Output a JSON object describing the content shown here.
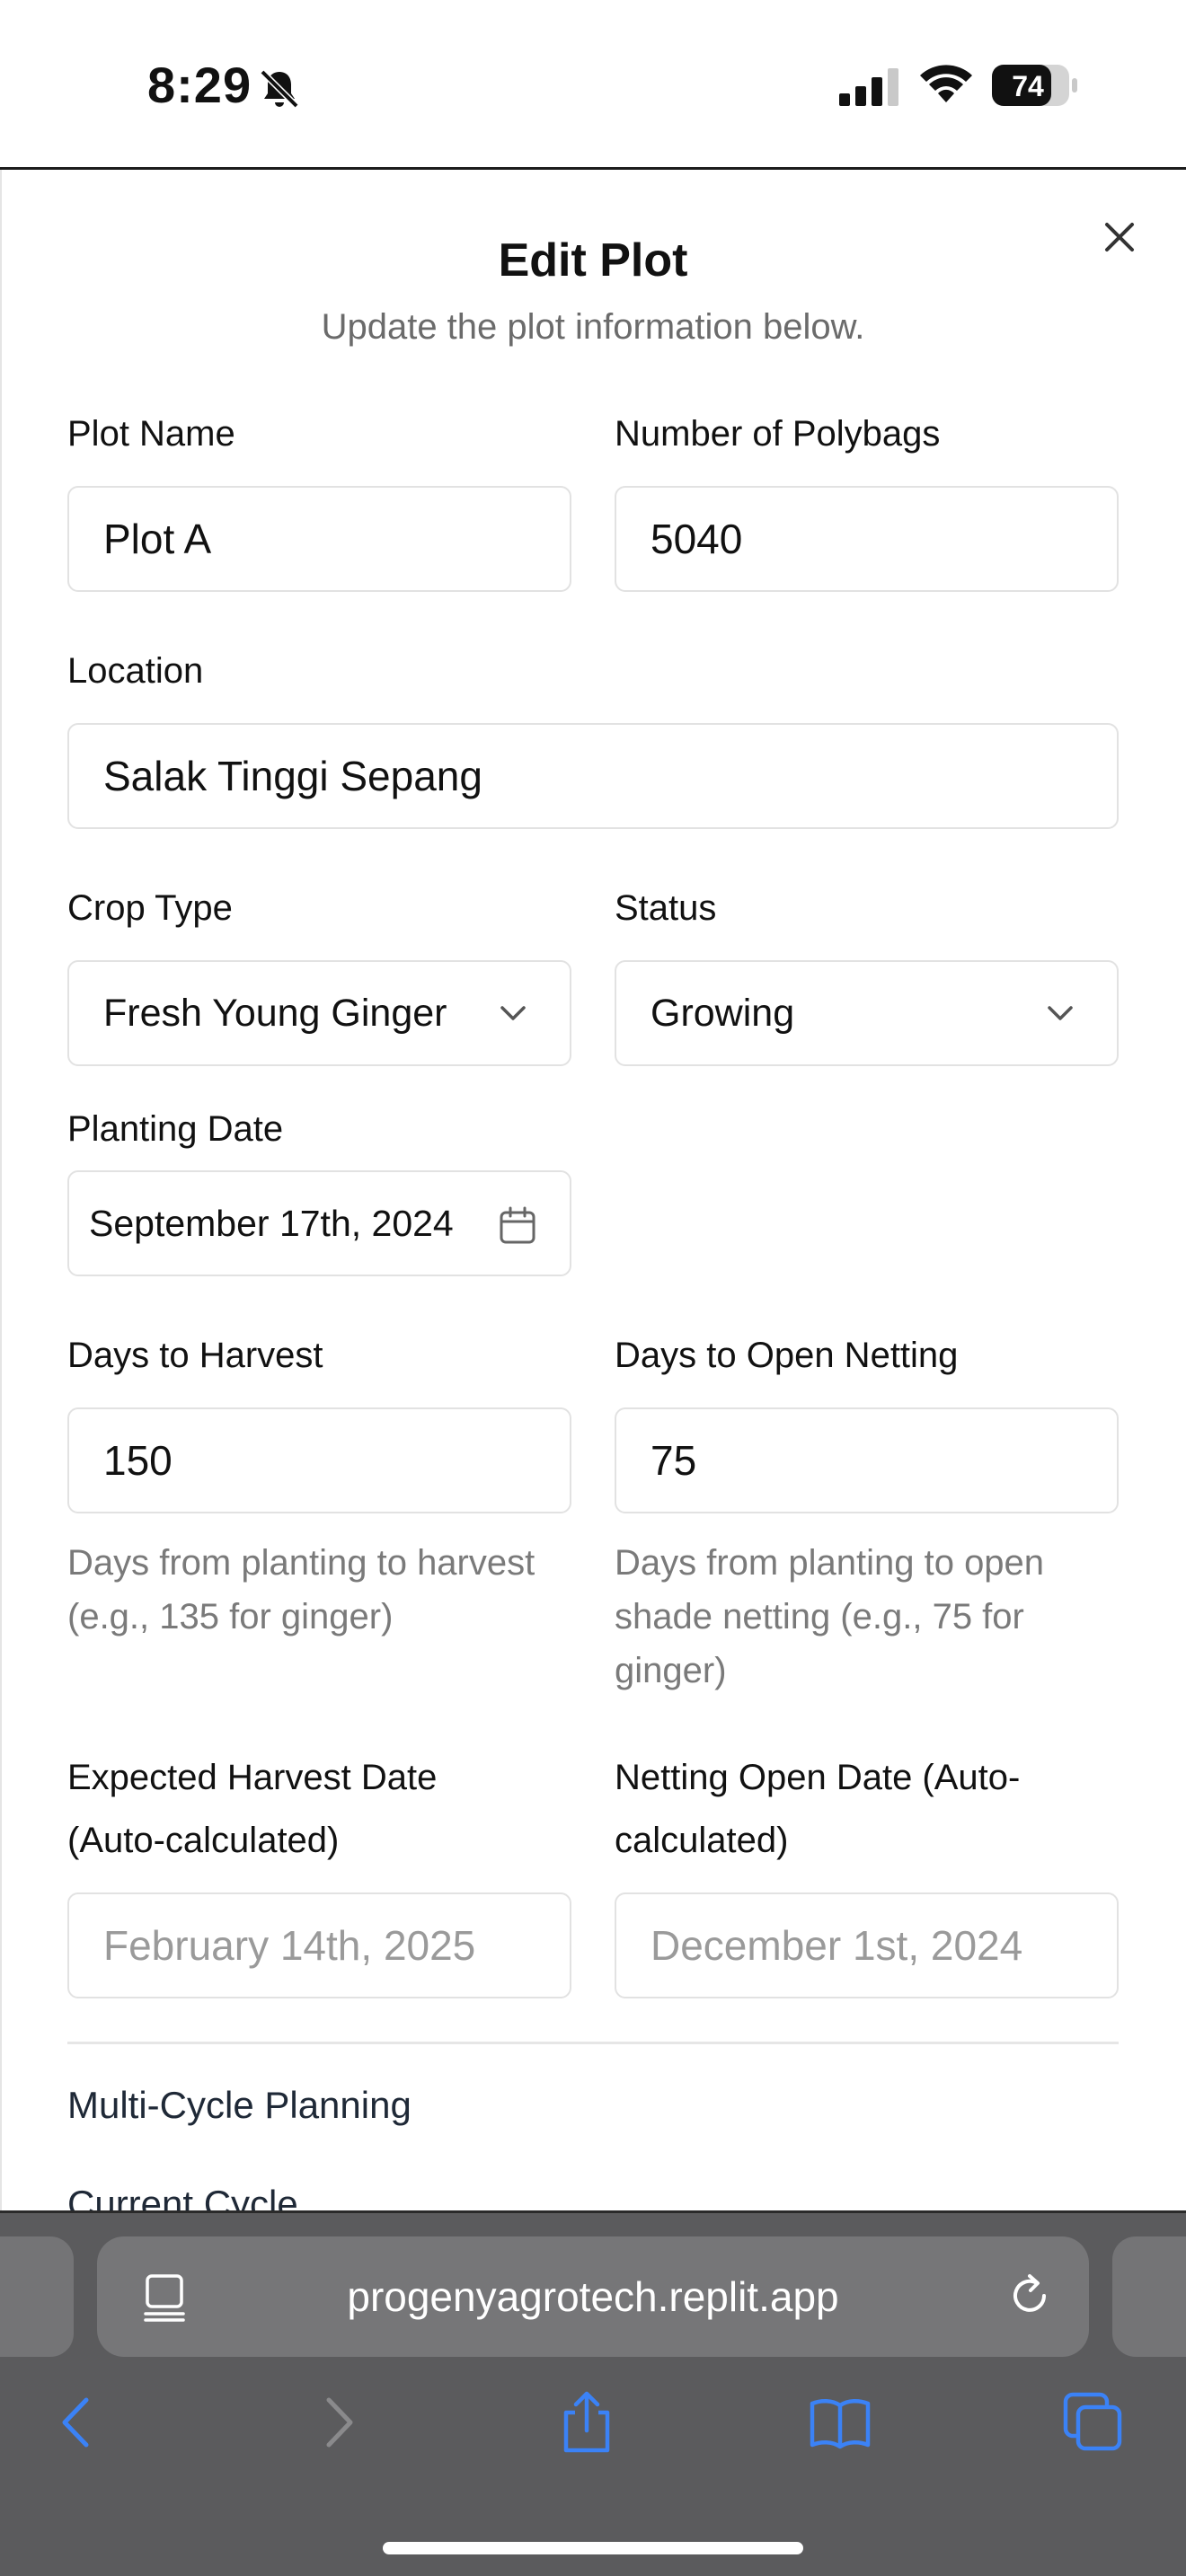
{
  "status_bar": {
    "time": "8:29",
    "battery": "74"
  },
  "dialog": {
    "title": "Edit Plot",
    "subtitle": "Update the plot information below.",
    "fields": {
      "plot_name": {
        "label": "Plot Name",
        "value": "Plot A"
      },
      "polybags": {
        "label": "Number of Polybags",
        "value": "5040"
      },
      "location": {
        "label": "Location",
        "value": "Salak Tinggi Sepang"
      },
      "crop_type": {
        "label": "Crop Type",
        "value": "Fresh Young Ginger"
      },
      "status": {
        "label": "Status",
        "value": "Growing"
      },
      "planting_date": {
        "label": "Planting Date",
        "value": "September 17th, 2024"
      },
      "days_to_harvest": {
        "label": "Days to Harvest",
        "value": "150",
        "help": "Days from planting to harvest (e.g., 135 for ginger)"
      },
      "days_to_netting": {
        "label": "Days to Open Netting",
        "value": "75",
        "help": "Days from planting to open shade netting (e.g., 75 for ginger)"
      },
      "expected_harvest": {
        "label": "Expected Harvest Date (Auto-calculated)",
        "value": "February 14th, 2025"
      },
      "netting_open": {
        "label": "Netting Open Date (Auto-calculated)",
        "value": "December 1st, 2024"
      }
    },
    "section_title": "Multi-Cycle Planning",
    "next_label": "Current Cycle"
  },
  "browser": {
    "url": "progenyagrotech.replit.app"
  },
  "colors": {
    "accent": "#3b82f6",
    "chrome": "#5b5b5d"
  }
}
